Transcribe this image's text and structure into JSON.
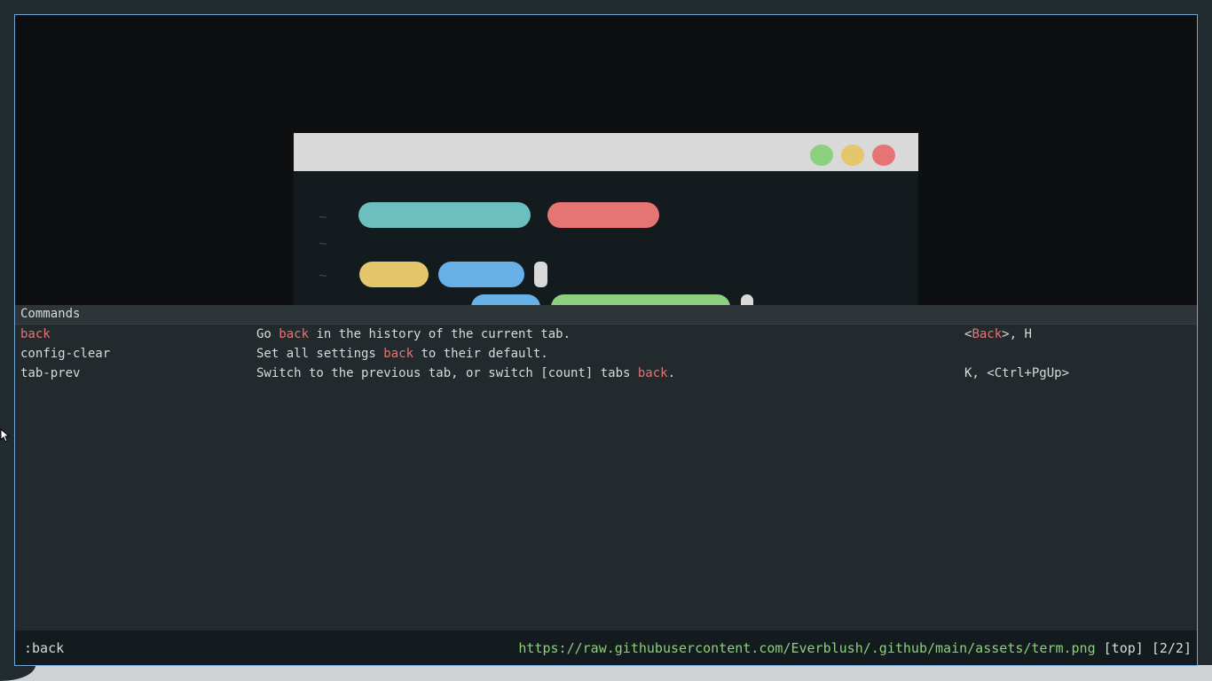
{
  "colors": {
    "window_border": "#6fa8d6",
    "highlight": "#e57474",
    "url": "#8ccf7e",
    "text": "#dadada",
    "background": "#232a2e"
  },
  "webview": {
    "image": {
      "titlebar_dots": [
        "#8ccf7e",
        "#e5c76b",
        "#e57474"
      ],
      "tilde": "~",
      "pill_colors": {
        "teal": "#6cbfbf",
        "red": "#e57474",
        "yellow": "#e5c76b",
        "blue": "#67b0e8",
        "light": "#d9d9d9",
        "green": "#8ccf7e"
      }
    }
  },
  "completion": {
    "header": "Commands",
    "rows": [
      {
        "name": "back",
        "desc_before": "Go ",
        "desc_match": "back",
        "desc_after": " in the history of the current tab.",
        "keys_before": "<",
        "keys_match": "Back",
        "keys_after": ">, H"
      },
      {
        "name": "config-clear",
        "desc_before": "Set all settings ",
        "desc_match": "back",
        "desc_after": " to their default.",
        "keys": ""
      },
      {
        "name": "tab-prev",
        "desc_before": "Switch to the previous tab, or switch [count] tabs ",
        "desc_match": "back",
        "desc_after": ".",
        "keys": "K, <Ctrl+PgUp>"
      }
    ]
  },
  "statusbar": {
    "command": ":back",
    "url": "https://raw.githubusercontent.com/Everblush/.github/main/assets/term.png",
    "position": "[top]",
    "tabs": "[2/2]"
  }
}
